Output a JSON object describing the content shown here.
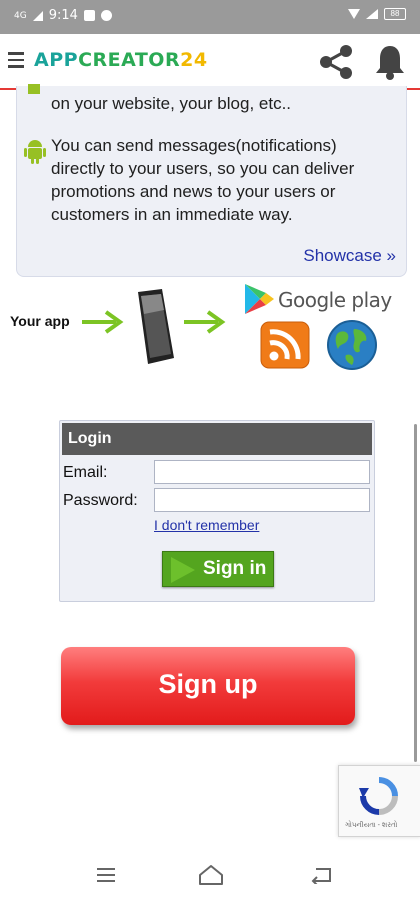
{
  "status_bar": {
    "network": "4G",
    "time": "9:14",
    "battery": "88"
  },
  "header": {
    "logo_app": "APP",
    "logo_creator": "CREATOR",
    "logo_num": "24",
    "icons": [
      "menu-icon",
      "share-icon",
      "bell-icon"
    ]
  },
  "info": {
    "line1": "on your website, your blog, etc..",
    "paragraph": "You can send messages(notifications) directly to your users, so you can deliver promotions and news to your users or customers in an immediate way.",
    "showcase_link": "Showcase »"
  },
  "diagram": {
    "your_app": "Your app",
    "google_play": "Google play"
  },
  "login": {
    "title": "Login",
    "email_label": "Email:",
    "email_value": "",
    "password_label": "Password:",
    "password_value": "",
    "forgot_link": "I don't remember",
    "signin_label": "Sign in"
  },
  "signup": {
    "label": "Sign up"
  },
  "recaptcha": {
    "footer": "ગોપનીયતા - શરતો"
  },
  "navbar": {
    "icons": [
      "recents-icon",
      "home-icon",
      "back-icon"
    ]
  },
  "colors": {
    "header_accent": "#e53935",
    "link": "#2332a8",
    "signin_green": "#54a51f",
    "signup_red": "#e21b1b",
    "card_bg": "#eef0f6"
  }
}
